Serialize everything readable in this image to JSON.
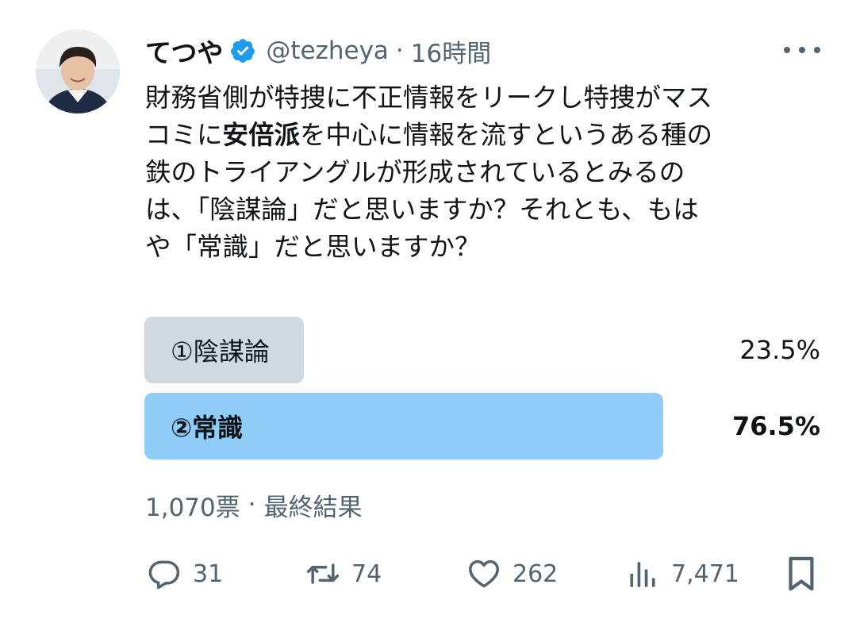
{
  "tweet": {
    "author_name": "てつや",
    "handle": "@tezheya",
    "separator": "·",
    "time": "16時間",
    "text_lines": [
      [
        "財務省側が特捜に不正情報をリークし特捜がマス"
      ],
      [
        "コミに",
        "安倍派",
        "を中心に情報を流すという",
        "ある種の"
      ],
      [
        "鉄のトライアングルが形成されているとみるの"
      ],
      [
        "は、「陰謀論」だと思いますか？それとも、もは"
      ],
      [
        "や「常識」だと思いますか？"
      ]
    ]
  },
  "poll": {
    "options": [
      {
        "label": "①陰謀論",
        "percent_text": "23.5%",
        "percent": 23.5,
        "winner": false
      },
      {
        "label": "②常識",
        "percent_text": "76.5%",
        "percent": 76.5,
        "winner": true
      }
    ],
    "votes": "1,070票",
    "separator": "·",
    "status": "最終結果",
    "colors": {
      "loser_bar": "#cfd9de",
      "winner_bar": "#8ecdf8"
    }
  },
  "actions": {
    "replies": "31",
    "retweets": "74",
    "likes": "262",
    "views": "7,471"
  },
  "icons": {
    "verified": "verified-badge-icon",
    "more": "more-options-icon",
    "reply": "reply-icon",
    "retweet": "retweet-icon",
    "like": "heart-icon",
    "views": "views-icon",
    "bookmark": "bookmark-icon"
  },
  "colors": {
    "accent": "#1d9bf0",
    "secondary_text": "#536471",
    "text": "#0f1419"
  }
}
